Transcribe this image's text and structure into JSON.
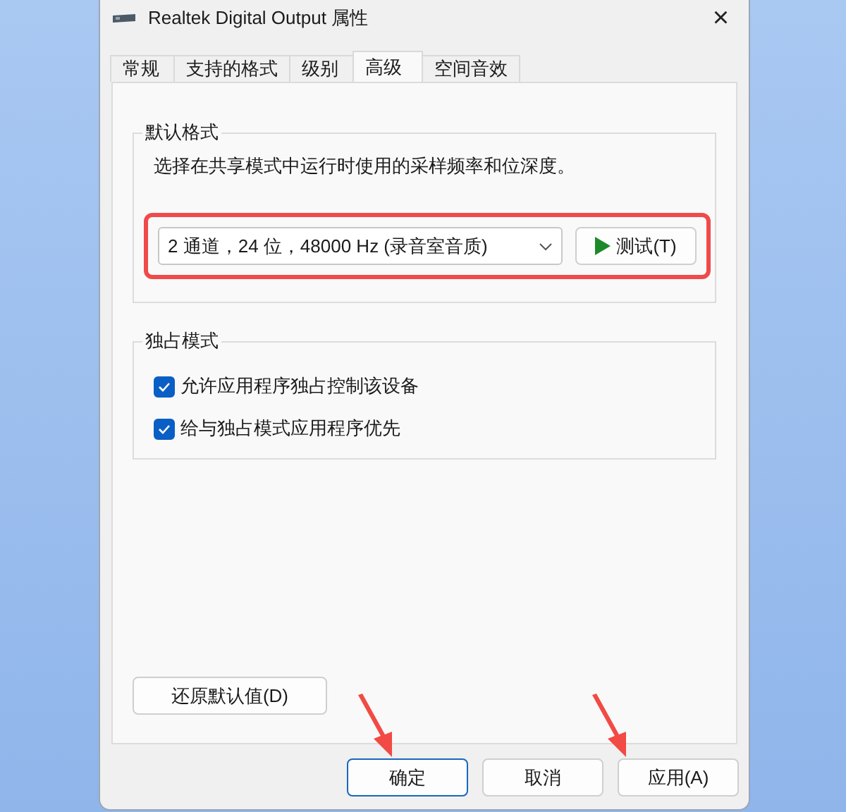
{
  "window": {
    "title": "Realtek Digital Output 属性",
    "close": "×"
  },
  "tabs": [
    {
      "label": "常规",
      "selected": false
    },
    {
      "label": "支持的格式",
      "selected": false
    },
    {
      "label": "级别",
      "selected": false
    },
    {
      "label": "高级",
      "selected": true
    },
    {
      "label": "空间音效",
      "selected": false
    }
  ],
  "default_format": {
    "title": "默认格式",
    "description": "选择在共享模式中运行时使用的采样频率和位深度。",
    "format": "2 通道，24 位，48000 Hz (录音室音质)",
    "test_button": "测试(T)",
    "highlighted": true
  },
  "exclusive_mode": {
    "title": "独占模式",
    "options": [
      {
        "label": "允许应用程序独占控制该设备",
        "checked": true
      },
      {
        "label": "给与独占模式应用程序优先",
        "checked": true
      }
    ]
  },
  "restore_button": "还原默认值(D)",
  "buttons": [
    {
      "label": "确定",
      "default": true,
      "arrow": true
    },
    {
      "label": "取消",
      "default": false,
      "arrow": false
    },
    {
      "label": "应用(A)",
      "default": false,
      "arrow": true
    }
  ]
}
